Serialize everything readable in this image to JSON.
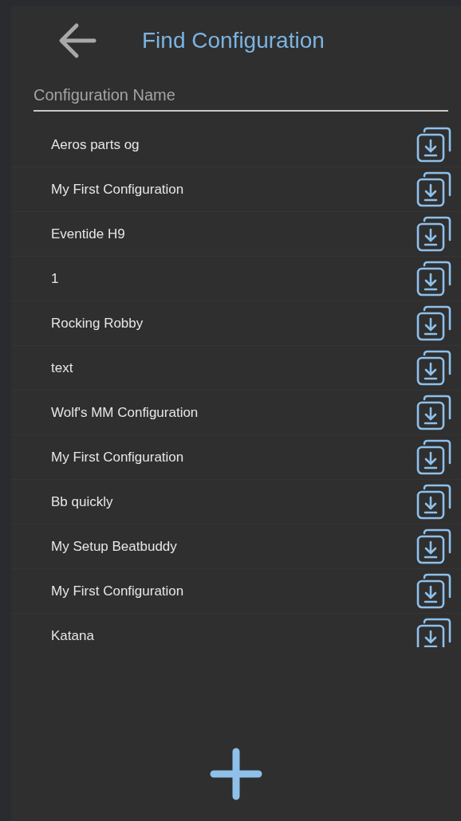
{
  "header": {
    "title": "Find Configuration"
  },
  "search": {
    "placeholder": "Configuration Name"
  },
  "configurations": [
    {
      "name": "Aeros parts og"
    },
    {
      "name": "My First Configuration"
    },
    {
      "name": "Eventide H9"
    },
    {
      "name": "1"
    },
    {
      "name": "Rocking Robby"
    },
    {
      "name": "text"
    },
    {
      "name": "Wolf's MM Configuration"
    },
    {
      "name": "My First Configuration"
    },
    {
      "name": "Bb quickly"
    },
    {
      "name": "My Setup Beatbuddy"
    },
    {
      "name": "My First Configuration"
    },
    {
      "name": "Katana"
    }
  ]
}
